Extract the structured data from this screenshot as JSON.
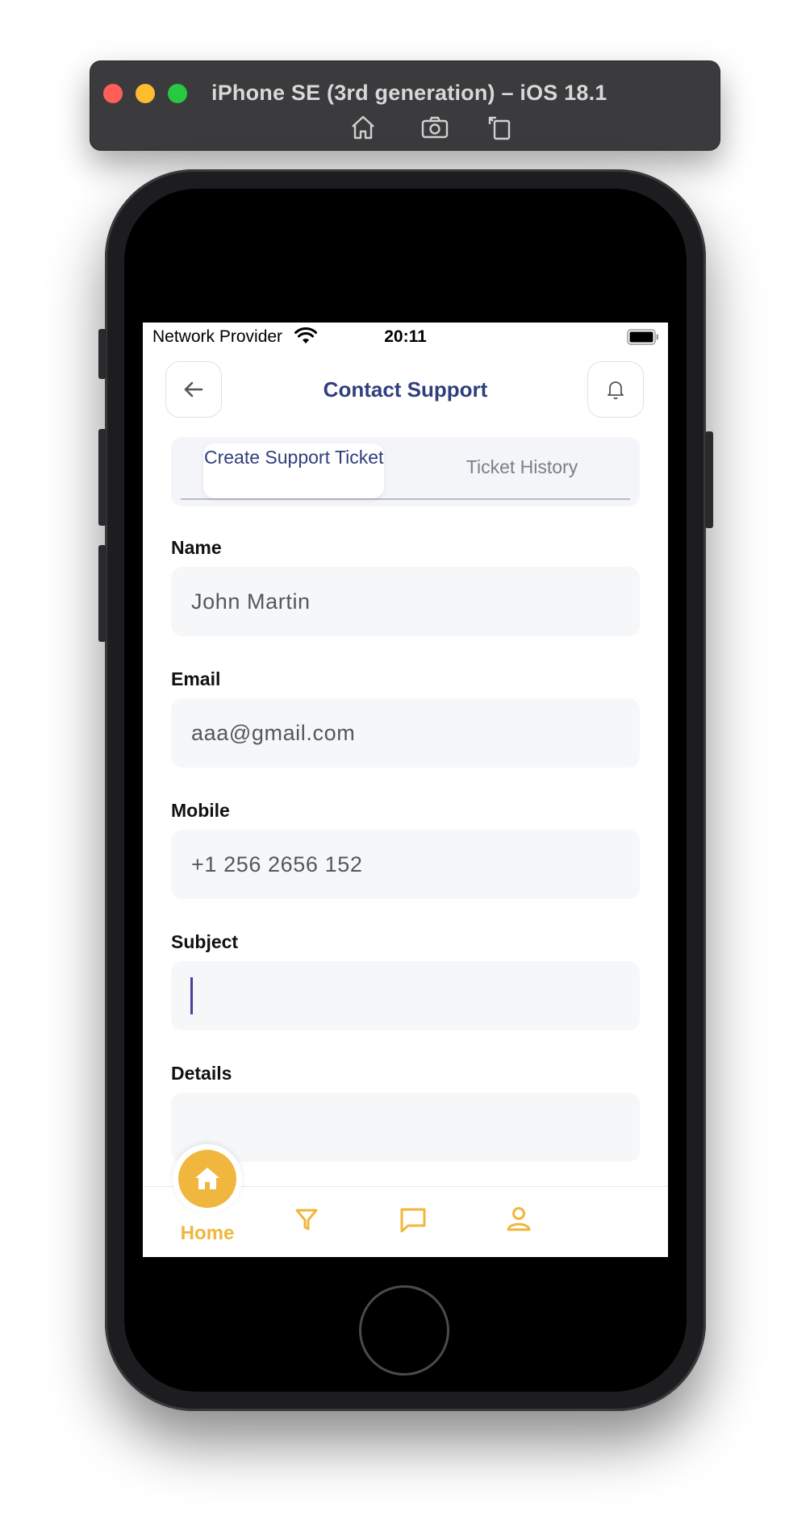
{
  "simulator": {
    "title": "iPhone SE (3rd generation) – iOS 18.1",
    "tools": [
      "home-icon",
      "screenshot-icon",
      "rotate-icon"
    ]
  },
  "status_bar": {
    "carrier": "Network Provider",
    "time": "20:11"
  },
  "header": {
    "title": "Contact Support",
    "back_icon": "arrow-left-icon",
    "notification_icon": "bell-icon"
  },
  "tabs": [
    {
      "label": "Create Support Ticket",
      "active": true
    },
    {
      "label": "Ticket History",
      "active": false
    }
  ],
  "form": {
    "name": {
      "label": "Name",
      "value": "John Martin"
    },
    "email": {
      "label": "Email",
      "value": "aaa@gmail.com"
    },
    "mobile": {
      "label": "Mobile",
      "value": "+1 256 2656 152"
    },
    "subject": {
      "label": "Subject",
      "value": ""
    },
    "details": {
      "label": "Details",
      "value": ""
    }
  },
  "bottom_nav": {
    "items": [
      {
        "label": "Home",
        "icon": "home-icon",
        "active": true
      },
      {
        "label": "",
        "icon": "filter-icon",
        "active": false
      },
      {
        "label": "",
        "icon": "chat-icon",
        "active": false
      },
      {
        "label": "",
        "icon": "profile-icon",
        "active": false
      }
    ]
  },
  "colors": {
    "primary": "#2f3f7e",
    "accent": "#f0b63d",
    "input_bg": "#f6f7f9"
  }
}
